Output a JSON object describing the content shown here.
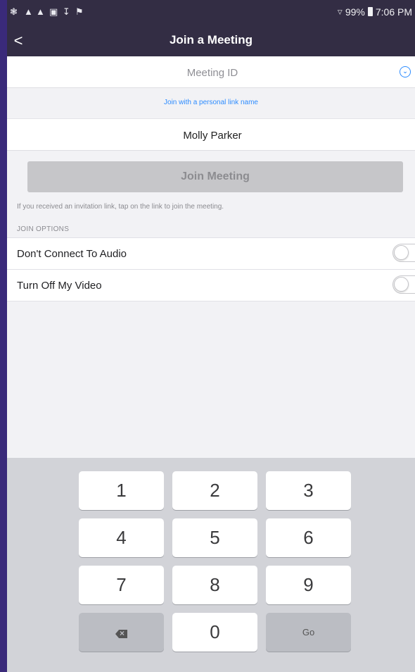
{
  "status_bar": {
    "icons_left": [
      "wrench-icon",
      "figure-icon",
      "figure-icon",
      "image-icon",
      "download-icon",
      "flag-icon"
    ],
    "wifi_icon": "wifi-icon",
    "battery_percent": "99%",
    "time": "7:06 PM"
  },
  "nav": {
    "back_glyph": "<",
    "title": "Join a Meeting"
  },
  "form": {
    "meeting_id_placeholder": "Meeting ID",
    "meeting_id_value": "",
    "dropdown_icon": "chevron-down-circle-icon",
    "personal_link_text": "Join with a personal link name",
    "name_value": "Molly Parker",
    "join_button": "Join Meeting",
    "invite_hint": "If you received an invitation link, tap on the link to join the meeting."
  },
  "join_options": {
    "header": "JOIN OPTIONS",
    "options": [
      {
        "label": "Don't Connect To Audio",
        "enabled": false
      },
      {
        "label": "Turn Off My Video",
        "enabled": false
      }
    ]
  },
  "keypad": {
    "keys": [
      "1",
      "2",
      "3",
      "4",
      "5",
      "6",
      "7",
      "8",
      "9",
      "0"
    ],
    "backspace_icon": "backspace-icon",
    "go_label": "Go"
  },
  "colors": {
    "nav_bg": "#332d44",
    "link_blue": "#2d8cff",
    "outer_frame": "#3a2a7a",
    "keypad_bg": "#d2d3d8"
  }
}
